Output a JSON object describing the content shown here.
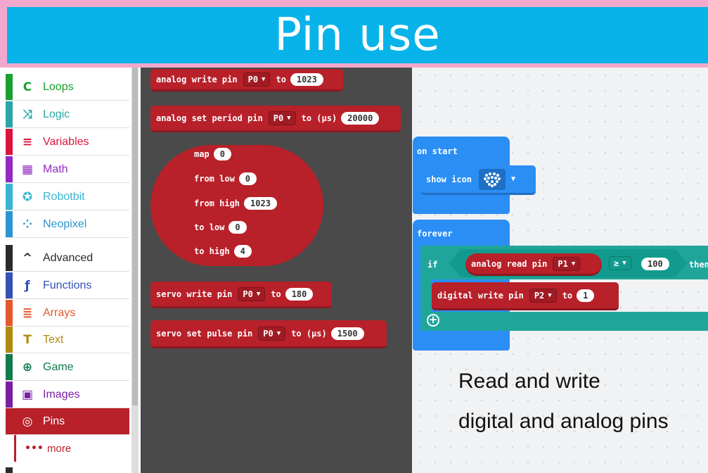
{
  "banner": {
    "title": "Pin use",
    "bg_color": "#08b3ea",
    "border_color": "#f2a8cc"
  },
  "sidebar": {
    "items": [
      {
        "label": "Loops",
        "icon": "loop-arrow-icon",
        "glyph": "C",
        "color": "#19a02e"
      },
      {
        "label": "Logic",
        "icon": "shuffle-icon",
        "glyph": "⤨",
        "color": "#2aa6a6"
      },
      {
        "label": "Variables",
        "icon": "list-lines-icon",
        "glyph": "≡",
        "color": "#dc143c"
      },
      {
        "label": "Math",
        "icon": "calculator-icon",
        "glyph": "▦",
        "color": "#9429c2"
      },
      {
        "label": "Robotbit",
        "icon": "rebel-icon",
        "glyph": "✪",
        "color": "#37b5d2"
      },
      {
        "label": "Neopixel",
        "icon": "dotted-circle-icon",
        "glyph": "⁘",
        "color": "#2b95d1"
      },
      {
        "label": "Advanced",
        "icon": "chevron-up-icon",
        "glyph": "^",
        "color": "#2a2a2a"
      },
      {
        "label": "Functions",
        "icon": "function-icon",
        "glyph": "ƒ",
        "color": "#3451b4"
      },
      {
        "label": "Arrays",
        "icon": "array-list-icon",
        "glyph": "≣",
        "color": "#e5582e"
      },
      {
        "label": "Text",
        "icon": "text-t-icon",
        "glyph": "T",
        "color": "#b08a10"
      },
      {
        "label": "Game",
        "icon": "gamepad-icon",
        "glyph": "⊕",
        "color": "#127a4b"
      },
      {
        "label": "Images",
        "icon": "image-icon",
        "glyph": "▣",
        "color": "#7a1fa2"
      },
      {
        "label": "Pins",
        "icon": "target-icon",
        "glyph": "◎",
        "color": "#b8202a"
      }
    ],
    "more": {
      "label": "more",
      "glyph": "•••"
    }
  },
  "flyout": {
    "analog_write": {
      "label": "analog write pin",
      "pin": "P0",
      "to": "to",
      "value": "1023"
    },
    "analog_period": {
      "label": "analog set period pin",
      "pin": "P0",
      "to": "to (µs)",
      "value": "20000"
    },
    "map": {
      "map": "map",
      "map_value": "0",
      "from_low": "from low",
      "from_low_value": "0",
      "from_high": "from high",
      "from_high_value": "1023",
      "to_low": "to low",
      "to_low_value": "0",
      "to_high": "to high",
      "to_high_value": "4"
    },
    "servo_write": {
      "label": "servo write pin",
      "pin": "P0",
      "to": "to",
      "value": "180"
    },
    "servo_pulse": {
      "label": "servo set pulse pin",
      "pin": "P0",
      "to": "to (µs)",
      "value": "1500"
    }
  },
  "workspace": {
    "on_start": {
      "label": "on start",
      "show_icon": "show icon"
    },
    "forever": {
      "label": "forever",
      "if": "if",
      "analog_read": "analog read pin",
      "read_pin": "P1",
      "operator": "≥",
      "threshold": "100",
      "then": "then",
      "digital_write": "digital write pin",
      "write_pin": "P2",
      "to": "to",
      "write_value": "1"
    },
    "caption_line1": "Read and write",
    "caption_line2": "digital and analog pins"
  }
}
